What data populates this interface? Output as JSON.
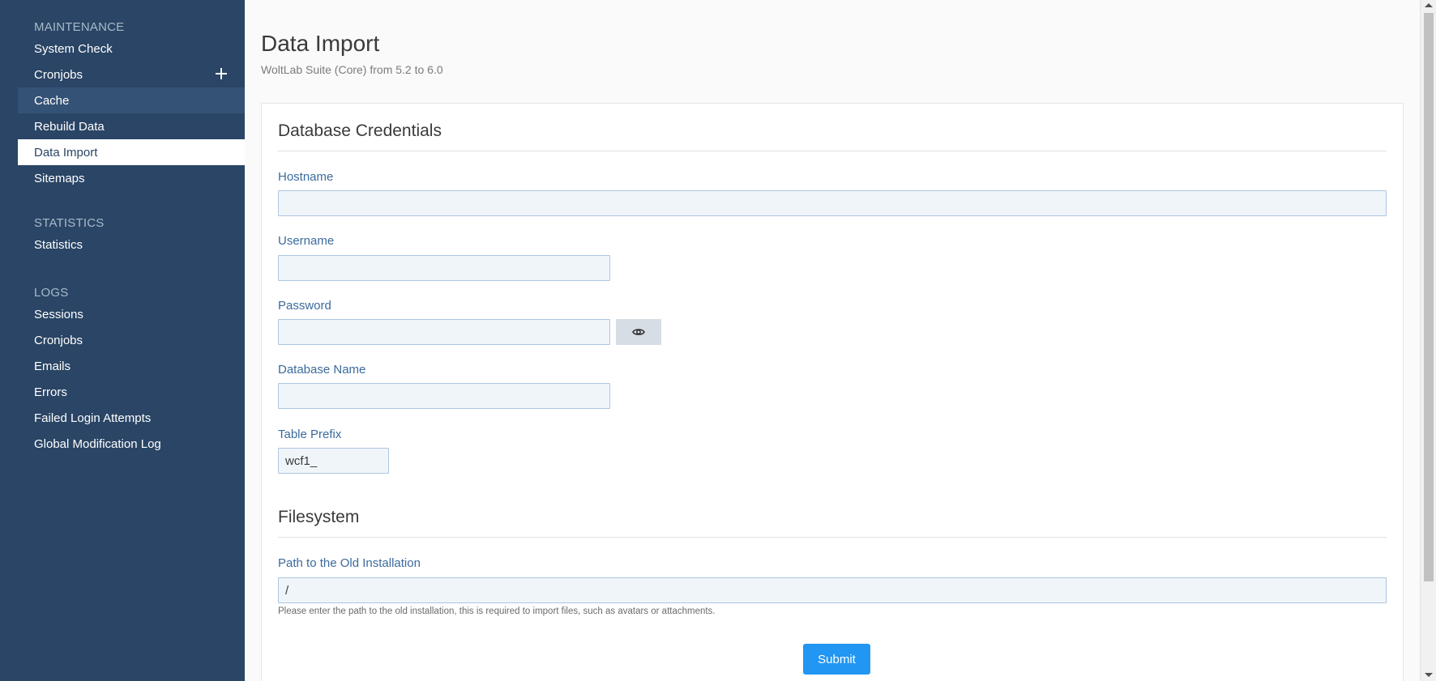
{
  "sidebar": {
    "sections": [
      {
        "title": "MAINTENANCE",
        "items": [
          {
            "label": "System Check"
          },
          {
            "label": "Cronjobs",
            "has_add": true
          },
          {
            "label": "Cache"
          },
          {
            "label": "Rebuild Data"
          },
          {
            "label": "Data Import"
          },
          {
            "label": "Sitemaps"
          }
        ]
      },
      {
        "title": "STATISTICS",
        "items": [
          {
            "label": "Statistics"
          }
        ]
      },
      {
        "title": "LOGS",
        "items": [
          {
            "label": "Sessions"
          },
          {
            "label": "Cronjobs"
          },
          {
            "label": "Emails"
          },
          {
            "label": "Errors"
          },
          {
            "label": "Failed Login Attempts"
          },
          {
            "label": "Global Modification Log"
          }
        ]
      }
    ],
    "active_item": "Data Import",
    "hover_item": "Cache"
  },
  "header": {
    "title": "Data Import",
    "subtitle": "WoltLab Suite (Core) from 5.2 to 6.0"
  },
  "form": {
    "database_section_title": "Database Credentials",
    "hostname": {
      "label": "Hostname",
      "value": ""
    },
    "username": {
      "label": "Username",
      "value": ""
    },
    "password": {
      "label": "Password",
      "value": ""
    },
    "database_name": {
      "label": "Database Name",
      "value": ""
    },
    "table_prefix": {
      "label": "Table Prefix",
      "value": "wcf1_"
    },
    "filesystem_section_title": "Filesystem",
    "path": {
      "label": "Path to the Old Installation",
      "value": "/",
      "help": "Please enter the path to the old installation, this is required to import files, such as avatars or attachments."
    },
    "submit_label": "Submit"
  },
  "icons": {
    "add": "plus-icon",
    "show_password": "eye-icon"
  },
  "colors": {
    "sidebar_bg": "#2a4565",
    "label": "#3b6a9d",
    "input_bg": "#f0f5fa",
    "input_border": "#adc6e0",
    "primary_button": "#2196f3"
  }
}
